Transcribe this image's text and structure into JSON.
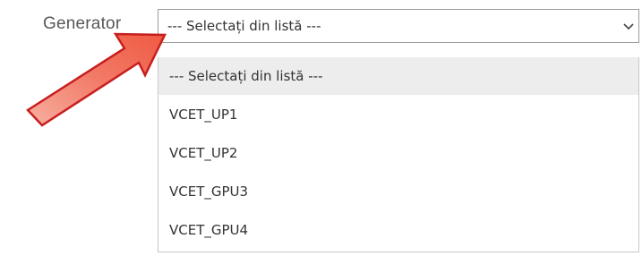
{
  "form": {
    "generator_label": "Generator",
    "generator_select": {
      "selected_value": "--- Selectați din listă ---",
      "chevron_icon": "chevron-down-icon",
      "options": [
        "--- Selectați din listă ---",
        "VCET_UP1",
        "VCET_UP2",
        "VCET_GPU3",
        "VCET_GPU4"
      ]
    }
  },
  "annotation": {
    "arrow_icon": "pointer-arrow-icon",
    "arrow_fill": "#f05a45",
    "arrow_stroke": "#c81e1e"
  }
}
